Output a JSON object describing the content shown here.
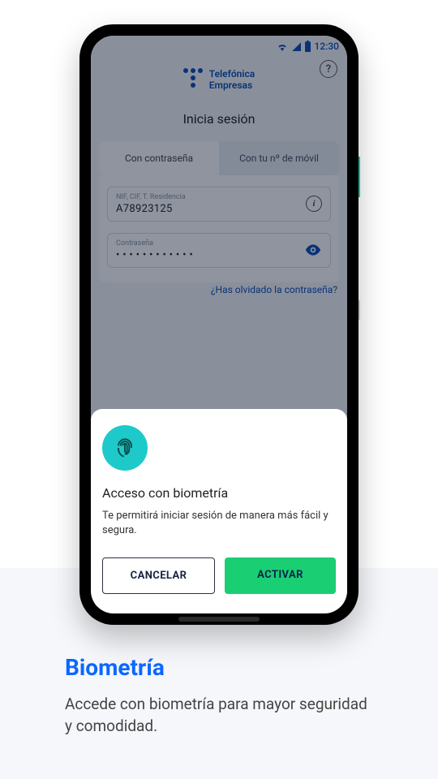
{
  "status": {
    "time": "12:30"
  },
  "brand": {
    "line1": "Telefónica",
    "line2": "Empresas"
  },
  "login": {
    "title": "Inicia sesión",
    "tabs": {
      "password": "Con contraseña",
      "mobile": "Con tu nº de móvil"
    },
    "id_field": {
      "label": "NIF, CIF, T. Residencia",
      "value": "A78923125"
    },
    "pwd_field": {
      "label": "Contraseña",
      "value": "• • • • • • • • • • • •"
    },
    "forgot": "¿Has olvidado la contraseña?"
  },
  "modal": {
    "title": "Acceso con biometría",
    "desc": "Te permitirá iniciar sesión de manera más fácil y segura.",
    "cancel": "CANCELAR",
    "activate": "ACTIVAR"
  },
  "caption": {
    "title": "Biometría",
    "desc": "Accede con biometría para mayor seguridad y comodidad."
  }
}
